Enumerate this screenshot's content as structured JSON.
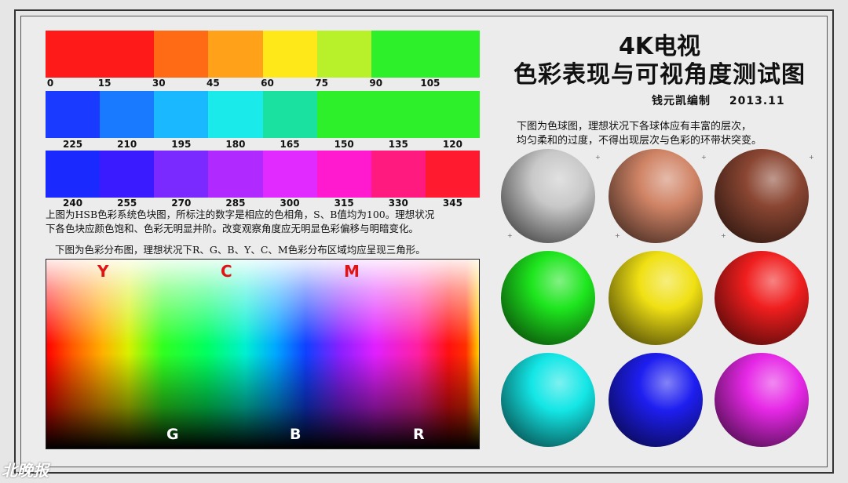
{
  "title": {
    "line1": "4K电视",
    "line2": "色彩表现与可视角度测试图"
  },
  "credit": {
    "author": "钱元凯编制",
    "date": "2013.11"
  },
  "hue_blocks": {
    "rows": [
      {
        "swatches": [
          {
            "color": "#ff1a1a",
            "flex": 2
          },
          {
            "color": "#ff6a14",
            "flex": 1
          },
          {
            "color": "#ffa21a",
            "flex": 1
          },
          {
            "color": "#ffe81a",
            "flex": 1
          },
          {
            "color": "#b8f02a",
            "flex": 1
          },
          {
            "color": "#2ef02a",
            "flex": 2
          }
        ],
        "labels": [
          "0",
          "15",
          "30",
          "45",
          "60",
          "75",
          "90",
          "105"
        ]
      },
      {
        "swatches": [
          {
            "color": "#1a3aff",
            "flex": 1
          },
          {
            "color": "#1a7aff",
            "flex": 1
          },
          {
            "color": "#1ab8ff",
            "flex": 1
          },
          {
            "color": "#1aeaea",
            "flex": 1
          },
          {
            "color": "#1ae0a0",
            "flex": 1
          },
          {
            "color": "#2ef02a",
            "flex": 3
          }
        ],
        "labels": [
          "225",
          "210",
          "195",
          "180",
          "165",
          "150",
          "135",
          "120"
        ]
      },
      {
        "swatches": [
          {
            "color": "#1a2aff",
            "flex": 1
          },
          {
            "color": "#3a1aff",
            "flex": 1
          },
          {
            "color": "#7a2aff",
            "flex": 1
          },
          {
            "color": "#b02aff",
            "flex": 1
          },
          {
            "color": "#e02aff",
            "flex": 1
          },
          {
            "color": "#ff1ad0",
            "flex": 1
          },
          {
            "color": "#ff1a80",
            "flex": 1
          },
          {
            "color": "#ff1a30",
            "flex": 1
          }
        ],
        "labels": [
          "240",
          "255",
          "270",
          "285",
          "300",
          "315",
          "330",
          "345"
        ]
      }
    ]
  },
  "hsb_description": {
    "line1": "上图为HSB色彩系统色块图，所标注的数字是相应的色相角，S、B值均为100。理想状况",
    "line2": "下各色块应颜色饱和、色彩无明显并阶。改变观察角度应无明显色彩偏移与明暗变化。"
  },
  "distribution": {
    "caption": "下图为色彩分布图，理想状况下R、G、B、Y、C、M色彩分布区域均应呈现三角形。",
    "top_labels": [
      "Y",
      "C",
      "M"
    ],
    "bottom_labels": [
      "G",
      "B",
      "R"
    ]
  },
  "sphere_description": {
    "line1": "下图为色球图，理想状况下各球体应有丰富的层次，",
    "line2": "均匀柔和的过度，不得出现层次与色彩的环带状突变。"
  },
  "spheres": [
    {
      "name": "gray",
      "color": "#c8c8c8"
    },
    {
      "name": "salmon",
      "color": "#d08466"
    },
    {
      "name": "brown",
      "color": "#8a4632"
    },
    {
      "name": "green",
      "color": "#1ee61e"
    },
    {
      "name": "yellow",
      "color": "#f0e014"
    },
    {
      "name": "red",
      "color": "#f01e1e"
    },
    {
      "name": "cyan",
      "color": "#14e6e6"
    },
    {
      "name": "blue",
      "color": "#1e1ef0"
    },
    {
      "name": "magenta",
      "color": "#e628e6"
    }
  ],
  "watermark": "北晚报"
}
